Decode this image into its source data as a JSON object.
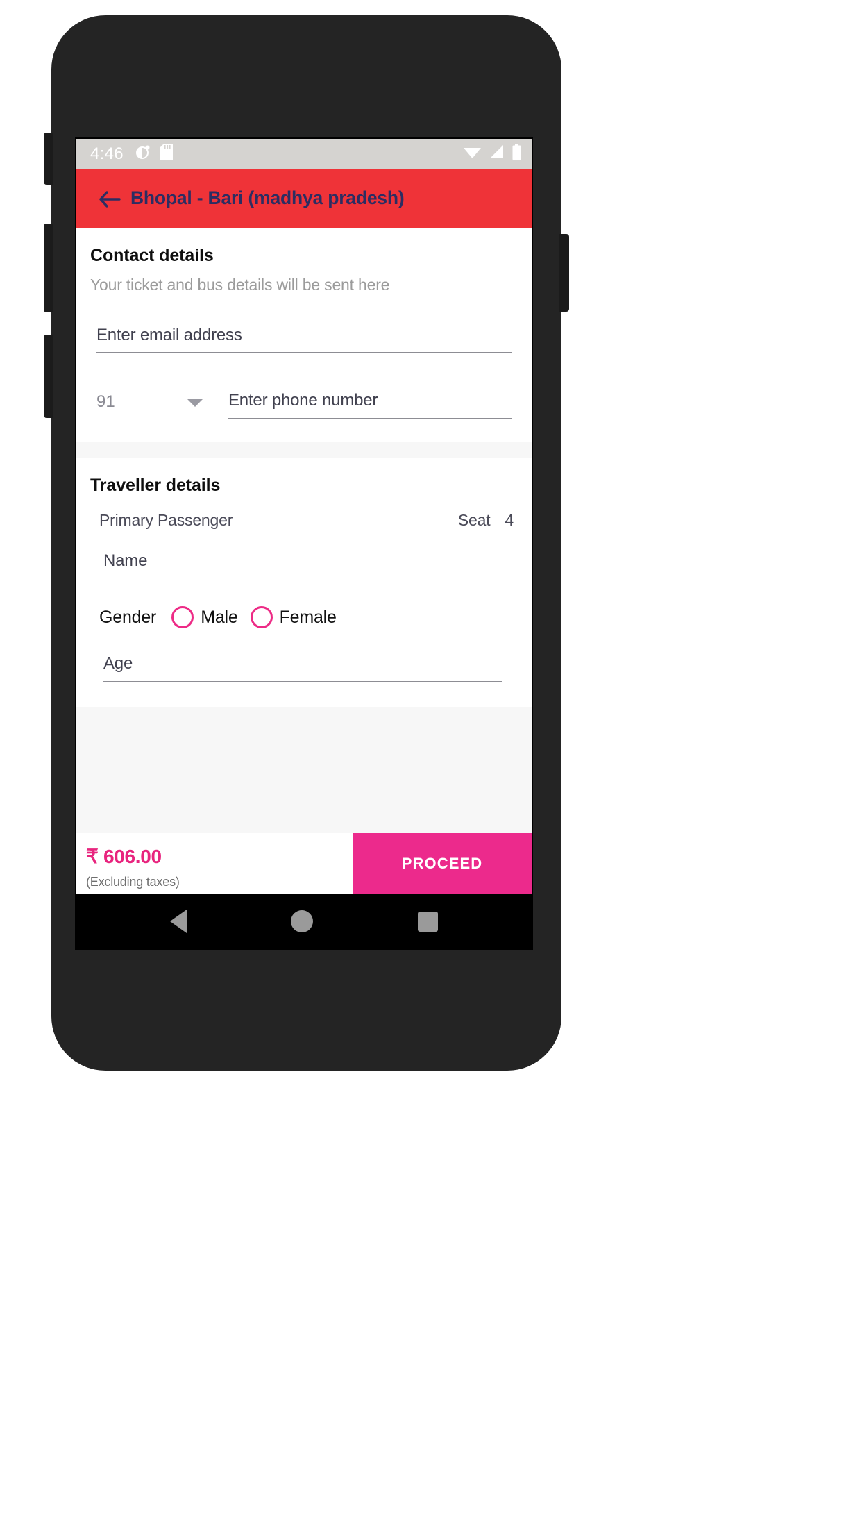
{
  "status_bar": {
    "time": "4:46",
    "left_icons": [
      "alarm-clock-icon",
      "sd-card-icon"
    ],
    "right_icons": [
      "wifi-icon",
      "cell-signal-icon",
      "battery-icon"
    ]
  },
  "app_bar": {
    "back_icon": "back-arrow-icon",
    "title": "Bhopal - Bari (madhya pradesh)",
    "background_color": "#ef3338",
    "title_color": "#2c2d62"
  },
  "contact": {
    "title": "Contact details",
    "subtitle": "Your ticket and bus details will be sent here",
    "email": {
      "value": "",
      "placeholder": "Enter email address"
    },
    "country_code": {
      "value": "91",
      "caret_icon": "chevron-down-icon"
    },
    "phone": {
      "value": "",
      "placeholder": "Enter phone number"
    }
  },
  "traveller": {
    "title": "Traveller details",
    "passenger_label": "Primary Passenger",
    "seat_label": "Seat",
    "seat_number": "4",
    "name": {
      "value": "",
      "placeholder": "Name"
    },
    "gender": {
      "label": "Gender",
      "options": [
        "Male",
        "Female"
      ],
      "selected": "",
      "accent_color": "#ed2b86"
    },
    "age": {
      "value": "",
      "placeholder": "Age"
    }
  },
  "bottom_bar": {
    "price": "₹ 606.00",
    "price_note": "(Excluding taxes)",
    "price_color": "#e8247e",
    "proceed_label": "PROCEED",
    "proceed_color": "#ec2a8c"
  },
  "nav_bar": {
    "back": "back-triangle-icon",
    "home": "home-circle-icon",
    "recents": "recents-square-icon"
  }
}
